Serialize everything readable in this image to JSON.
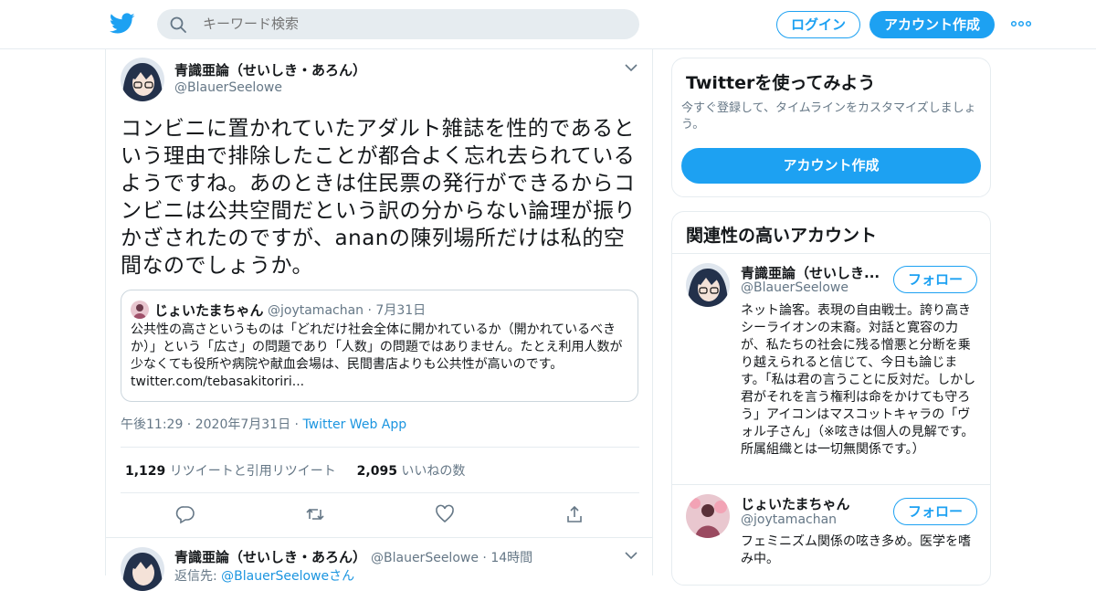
{
  "header": {
    "logo": "twitter-bird-icon",
    "search_placeholder": "キーワード検索",
    "login_label": "ログイン",
    "signup_label": "アカウント作成",
    "more": "more-icon"
  },
  "tweet": {
    "name": "青識亜論（せいしき・あろん）",
    "handle": "@BlauerSeelowe",
    "text": "コンビニに置かれていたアダルト雑誌を性的であるという理由で排除したことが都合よく忘れ去られているようですね。あのときは住民票の発行ができるからコンビニは公共空間だという訳の分からない論理が振りかざされたのですが、ananの陳列場所だけは私的空間なのでしょうか。",
    "quote": {
      "name": "じょいたまちゃん",
      "handle": "@joytamachan",
      "date": "7月31日",
      "text": "公共性の高さというものは「どれだけ社会全体に開かれているか（開かれているべきか）」という「広さ」の問題であり「人数」の問題ではありません。たとえ利用人数が少なくても役所や病院や献血会場は、民間書店よりも公共性が高いのです。",
      "link": "twitter.com/tebasakitoriri..."
    },
    "time": "午後11:29",
    "date": "2020年7月31日",
    "source": "Twitter Web App",
    "retweets": "1,129",
    "retweets_label": "リツイートと引用リツイート",
    "likes": "2,095",
    "likes_label": "いいねの数"
  },
  "reply": {
    "name": "青識亜論（せいしき・あろん）",
    "handle": "@BlauerSeelowe",
    "age": "14時間",
    "reply_prefix": "返信先:",
    "reply_to": "@BlauerSeeloweさん"
  },
  "sidebar": {
    "signup_card": {
      "title": "Twitterを使ってみよう",
      "subtitle": "今すぐ登録して、タイムラインをカスタマイズしましょう。",
      "button": "アカウント作成"
    },
    "related": {
      "title": "関連性の高いアカウント",
      "accounts": [
        {
          "name": "青識亜論（せいしき...",
          "handle": "@BlauerSeelowe",
          "follow": "フォロー",
          "bio": "ネット論客。表現の自由戦士。誇り高きシーライオンの末裔。対話と寛容の力が、私たちの社会に残る憎悪と分断を乗り越えられると信じて、今日も論じます。「私は君の言うことに反対だ。しかし君がそれを言う権利は命をかけても守ろう」アイコンはマスコットキャラの「ヴォル子さん」（※呟きは個人の見解です。所属組織とは一切無関係です。）"
        },
        {
          "name": "じょいたまちゃん",
          "handle": "@joytamachan",
          "follow": "フォロー",
          "bio": "フェミニズム関係の呟き多め。医学を嗜み中。"
        }
      ]
    }
  },
  "colors": {
    "accent": "#1da1f2",
    "muted": "#657786",
    "border": "#e6ecf0"
  }
}
